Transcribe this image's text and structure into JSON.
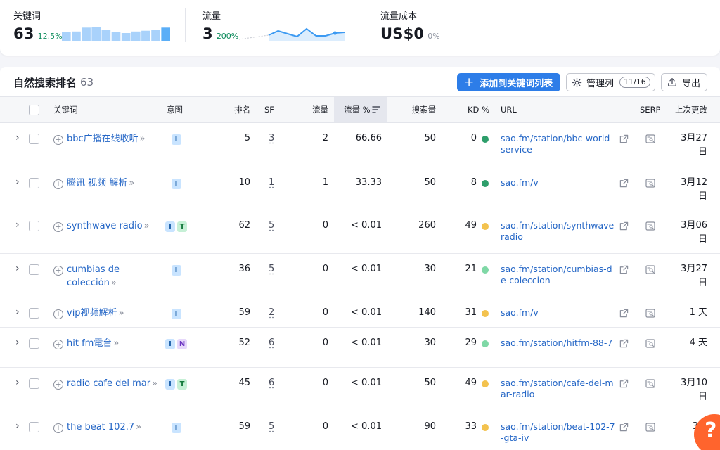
{
  "metrics": [
    {
      "label": "关键词",
      "value": "63",
      "change": "12.5%"
    },
    {
      "label": "流量",
      "value": "3",
      "change": "200%"
    },
    {
      "label": "流量成本",
      "value": "US$0",
      "change": "0%"
    }
  ],
  "keywords_sparkline": [
    0.55,
    0.6,
    0.85,
    0.9,
    0.7,
    0.55,
    0.5,
    0.6,
    0.65,
    0.7,
    0.85
  ],
  "traffic_sparkline": [
    0.3,
    0.6,
    0.4,
    0.2,
    0.75,
    0.25,
    0.25,
    0.45,
    0.5
  ],
  "table": {
    "title": "自然搜索排名",
    "count": "63",
    "add_button": "添加到关键词列表",
    "manage_button": "管理列",
    "manage_badge": "11/16",
    "export_button": "导出",
    "headers": {
      "keyword": "关键词",
      "intent": "意图",
      "rank": "排名",
      "sf": "SF",
      "traffic": "流量",
      "traffic_pct": "流量 %",
      "volume": "搜索量",
      "kd": "KD %",
      "url": "URL",
      "serp": "SERP",
      "updated": "上次更改"
    },
    "rows": [
      {
        "keyword": "bbc广播在线收听",
        "intents": [
          "I"
        ],
        "rank": "5",
        "sf": "3",
        "traffic": "2",
        "traffic_pct": "66.66",
        "volume": "50",
        "kd": "0",
        "kd_color": "#2e9e6b",
        "url": "sao.fm/station/bbc-world-service",
        "updated": "3月27日"
      },
      {
        "keyword": "腾讯 视频 解析",
        "intents": [
          "I"
        ],
        "rank": "10",
        "sf": "1",
        "traffic": "1",
        "traffic_pct": "33.33",
        "volume": "50",
        "kd": "8",
        "kd_color": "#2e9e6b",
        "url": "sao.fm/v",
        "updated": "3月12日"
      },
      {
        "keyword": "synthwave radio",
        "intents": [
          "I",
          "T"
        ],
        "rank": "62",
        "sf": "5",
        "traffic": "0",
        "traffic_pct": "< 0.01",
        "volume": "260",
        "kd": "49",
        "kd_color": "#f3c24e",
        "url": "sao.fm/station/synthwave-radio",
        "updated": "3月06日"
      },
      {
        "keyword": "cumbias de colección",
        "intents": [
          "I"
        ],
        "rank": "36",
        "sf": "5",
        "traffic": "0",
        "traffic_pct": "< 0.01",
        "volume": "30",
        "kd": "21",
        "kd_color": "#7fd8a6",
        "url": "sao.fm/station/cumbias-de-coleccion",
        "updated": "3月27日"
      },
      {
        "keyword": "vip视频解析",
        "intents": [
          "I"
        ],
        "rank": "59",
        "sf": "2",
        "traffic": "0",
        "traffic_pct": "< 0.01",
        "volume": "140",
        "kd": "31",
        "kd_color": "#f3c24e",
        "url": "sao.fm/v",
        "updated": "1 天"
      },
      {
        "keyword": "hit fm電台",
        "intents": [
          "I",
          "N"
        ],
        "rank": "52",
        "sf": "6",
        "traffic": "0",
        "traffic_pct": "< 0.01",
        "volume": "30",
        "kd": "29",
        "kd_color": "#7fd8a6",
        "url": "sao.fm/station/hitfm-88-7",
        "updated": "4 天"
      },
      {
        "keyword": "radio cafe del mar",
        "intents": [
          "I",
          "T"
        ],
        "rank": "45",
        "sf": "6",
        "traffic": "0",
        "traffic_pct": "< 0.01",
        "volume": "50",
        "kd": "49",
        "kd_color": "#f3c24e",
        "url": "sao.fm/station/cafe-del-mar-radio",
        "updated": "3月10日"
      },
      {
        "keyword": "the beat 102.7",
        "intents": [
          "I"
        ],
        "rank": "59",
        "sf": "5",
        "traffic": "0",
        "traffic_pct": "< 0.01",
        "volume": "90",
        "kd": "33",
        "kd_color": "#f3c24e",
        "url": "sao.fm/station/beat-102-7-gta-iv",
        "updated": "3月"
      }
    ]
  },
  "help_label": "?"
}
